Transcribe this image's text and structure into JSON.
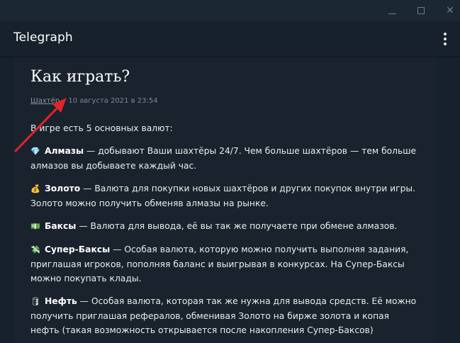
{
  "window": {
    "controls": {
      "minimize_icon": "minimize-icon",
      "maximize_icon": "maximize-icon",
      "close_icon": "close-icon",
      "close_glyph": "✕"
    }
  },
  "header": {
    "title": "Telegraph",
    "menu_icon": "kebab-menu-icon"
  },
  "article": {
    "title": "Как играть?",
    "author": "Шахтёр",
    "separator": " • ",
    "date": "10 августа 2021 в 23:54",
    "intro": "В игре есть 5 основных валют:",
    "currencies": [
      {
        "emoji": "💎",
        "name": "Алмазы",
        "text": " — добывают Ваши шахтёры 24/7. Чем больше шахтёров — тем больше алмазов вы добываете каждый час."
      },
      {
        "emoji": "💰",
        "name": "Золото",
        "text": " — Валюта для покупки новых шахтёров и других покупок внутри игры. Золото можно получить обменяв алмазы на рынке."
      },
      {
        "emoji": "💵",
        "name": "Баксы",
        "text": " — Валюта для вывода, её вы так же получаете при обмене алмазов."
      },
      {
        "emoji": "💸",
        "name": "Супер-Баксы",
        "text": " — Особая валюта, которую можно получить выполняя задания, приглашая игроков, пополняя баланс и выигрывая в конкурсах. На Супер-Баксы можно покупать клады."
      },
      {
        "emoji": "🛢",
        "name": "Нефть",
        "text": " — Особая валюта, которая так же нужна для вывода средств. Её можно получить приглашая рефералов, обменивая Золото на бирже золота и копая нефть (такая возможность открывается после накопления Супер-Баксов)"
      }
    ],
    "divider": "***"
  },
  "colors": {
    "background": "#17212b",
    "article_bg": "#1a232d",
    "annotation_arrow": "#e0242a"
  }
}
